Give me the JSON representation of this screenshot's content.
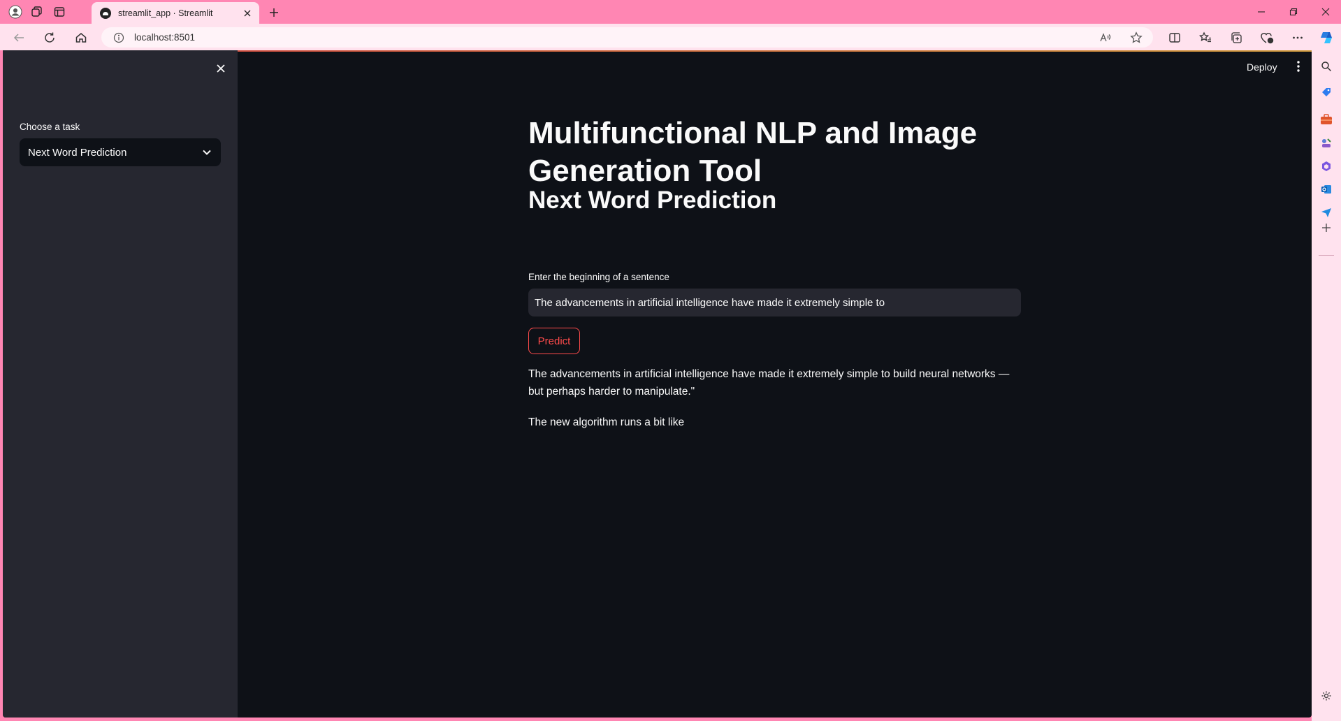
{
  "browser": {
    "tab_title": "streamlit_app · Streamlit",
    "url": "localhost:8501",
    "colors": {
      "frame": "#ff86b3",
      "toolbar": "#ffe2ee"
    }
  },
  "sidebar": {
    "label": "Choose a task",
    "selected_task": "Next Word Prediction"
  },
  "header": {
    "deploy_label": "Deploy"
  },
  "main": {
    "title": "Multifunctional NLP and Image Generation Tool",
    "subheader": "Next Word Prediction",
    "input_label": "Enter the beginning of a sentence",
    "input_value": "The advancements in artificial intelligence have made it extremely simple to",
    "button_label": "Predict",
    "output_lines": [
      "The advancements in artificial intelligence have made it extremely simple to build neural networks — but perhaps harder to manipulate.\"",
      "The new algorithm runs a bit like"
    ]
  },
  "colors": {
    "app_bg": "#0e1117",
    "sidebar_bg": "#262730",
    "text": "#fafafa",
    "accent": "#ff4b4b"
  }
}
